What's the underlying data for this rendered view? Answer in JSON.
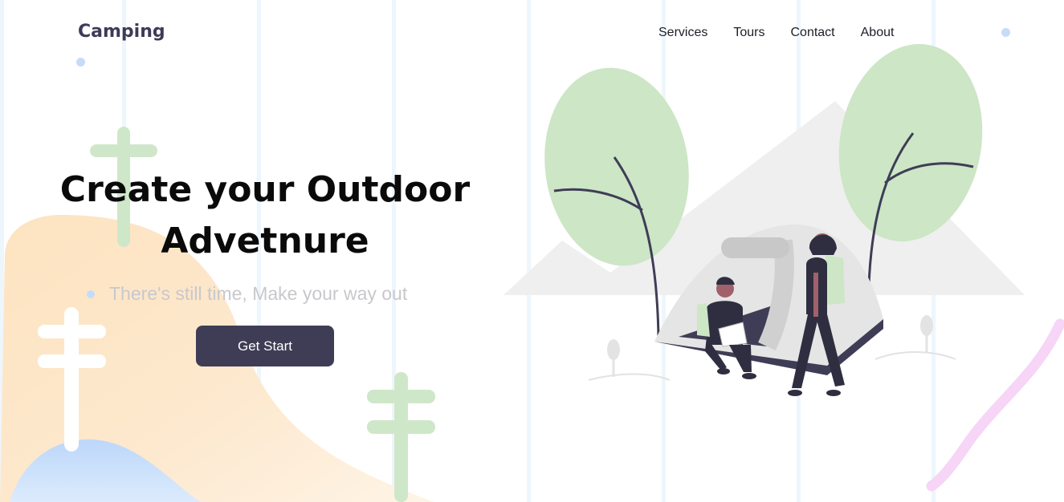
{
  "brand": {
    "name": "Camping"
  },
  "nav": {
    "items": [
      {
        "label": "Services"
      },
      {
        "label": "Tours"
      },
      {
        "label": "Contact"
      },
      {
        "label": "About"
      }
    ]
  },
  "hero": {
    "title_line1": "Create your Outdoor",
    "title_line2": "Advetnure",
    "subtitle": "There's still time, Make your way out",
    "cta_label": "Get Start"
  },
  "colors": {
    "primary": "#3f3d56",
    "leaf_green": "#cce6c6",
    "accent_blue": "#c6dbfa",
    "sand": "#fde2bd",
    "pink": "#f6d5f7"
  },
  "icons": {
    "tree_left": "stylized-tree",
    "illustration": "camping-tent-scene"
  }
}
